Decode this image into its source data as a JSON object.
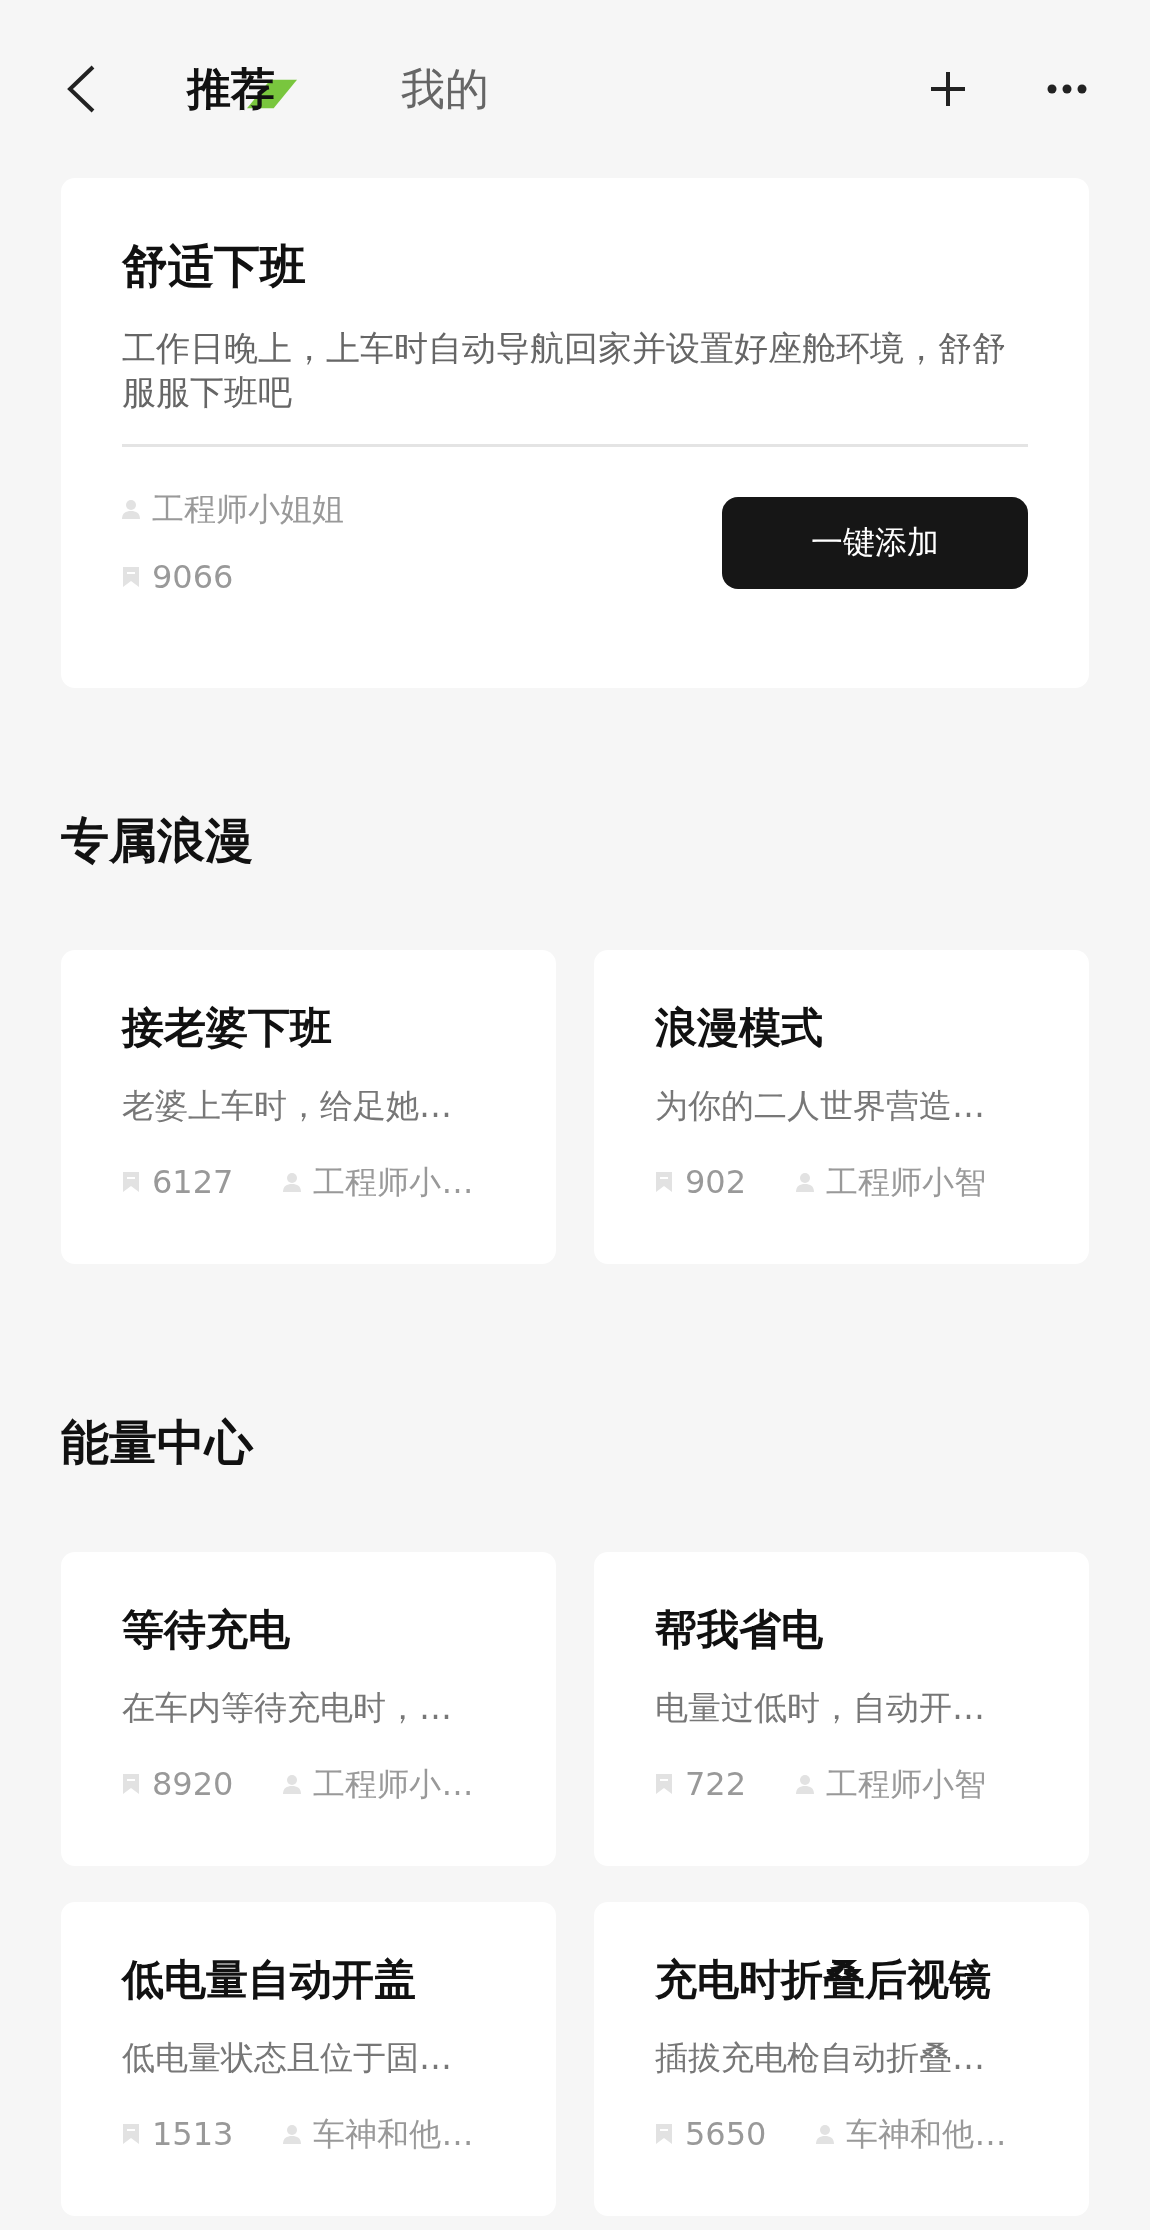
{
  "nav": {
    "tabs": [
      {
        "label": "推荐",
        "selected": true
      },
      {
        "label": "我的",
        "selected": false
      }
    ]
  },
  "featured": {
    "title": "舒适下班",
    "description": "工作日晚上，上车时自动导航回家并设置好座舱环境，舒舒服服下班吧",
    "author": "工程师小姐姐",
    "count": "9066",
    "button": "一键添加"
  },
  "sections": [
    {
      "title": "专属浪漫",
      "cards": [
        {
          "title": "接老婆下班",
          "description": "老婆上车时，给足她…",
          "count": "6127",
          "author": "工程师小…"
        },
        {
          "title": "浪漫模式",
          "description": "为你的二人世界营造…",
          "count": "902",
          "author": "工程师小智"
        }
      ]
    },
    {
      "title": "能量中心",
      "cards": [
        {
          "title": "等待充电",
          "description": "在车内等待充电时，…",
          "count": "8920",
          "author": "工程师小…"
        },
        {
          "title": "帮我省电",
          "description": "电量过低时，自动开…",
          "count": "722",
          "author": "工程师小智"
        },
        {
          "title": "低电量自动开盖",
          "description": "低电量状态且位于固…",
          "count": "1513",
          "author": "车神和他…"
        },
        {
          "title": "充电时折叠后视镜",
          "description": "插拔充电枪自动折叠…",
          "count": "5650",
          "author": "车神和他…"
        }
      ]
    }
  ]
}
